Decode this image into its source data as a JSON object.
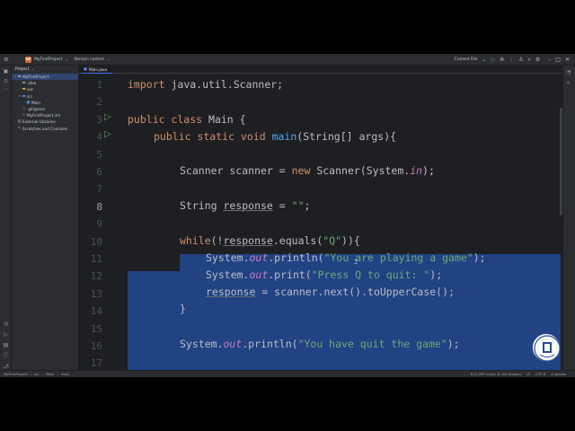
{
  "window": {
    "project_badge": "MF",
    "project_name": "MyFirstProject",
    "vcs": "Version control",
    "run_config": "Current File"
  },
  "project_panel": {
    "title": "Project",
    "tree": [
      {
        "label": "MyFirstProject",
        "indent": 0,
        "arrow": "▾",
        "icon": "folder",
        "selected": true
      },
      {
        "label": ".idea",
        "indent": 1,
        "arrow": "›",
        "icon": "folder",
        "selected": false
      },
      {
        "label": "out",
        "indent": 1,
        "arrow": "›",
        "icon": "folder-orange",
        "selected": false
      },
      {
        "label": "src",
        "indent": 1,
        "arrow": "▾",
        "icon": "folder-blue",
        "selected": false
      },
      {
        "label": "Main",
        "indent": 2,
        "arrow": "",
        "icon": "class",
        "selected": false
      },
      {
        "label": ".gitignore",
        "indent": 1,
        "arrow": "",
        "icon": "file",
        "selected": false
      },
      {
        "label": "MyFirstProject.iml",
        "indent": 1,
        "arrow": "",
        "icon": "file",
        "selected": false
      },
      {
        "label": "External Libraries",
        "indent": 0,
        "arrow": "›",
        "icon": "library",
        "selected": false
      },
      {
        "label": "Scratches and Consoles",
        "indent": 0,
        "arrow": "",
        "icon": "scratch",
        "selected": false
      }
    ]
  },
  "editor": {
    "tab_label": "Main.java",
    "line_numbers": [
      "1",
      "2",
      "3",
      "4",
      "5",
      "6",
      "7",
      "8",
      "9",
      "10",
      "11",
      "12",
      "13",
      "14",
      "15",
      "16",
      "17"
    ],
    "active_line": "8",
    "lines": {
      "l1": {
        "kw": "import",
        "rest": " java.util.Scanner;"
      },
      "l3": {
        "kw": "public class",
        "rest": " Main {"
      },
      "l4": {
        "kw": "public static void",
        "fn": "main",
        "rest": "(String[] args){"
      },
      "l6": {
        "a": "Scanner scanner = ",
        "kw": "new",
        "b": " Scanner(System.",
        "field": "in",
        "c": ");"
      },
      "l8": {
        "a": "String ",
        "var": "response",
        "b": " = ",
        "str": "\"\"",
        "c": ";"
      },
      "l10": {
        "kw": "while",
        "a": "(!",
        "var": "response",
        "b": ".equals(",
        "str": "\"Q\"",
        "c": ")){"
      },
      "l11": {
        "a": "System.",
        "field": "out",
        "b": ".println(",
        "str": "\"You are playing a game\"",
        "c": ");"
      },
      "l12": {
        "a": "System.",
        "field": "out",
        "b": ".print(",
        "str": "\"Press Q to quit: \"",
        "c": ");"
      },
      "l13": {
        "var": "response",
        "a": " = scanner.next().toUpperCase();"
      },
      "l14": {
        "a": "}"
      },
      "l16": {
        "a": "System.",
        "field": "out",
        "b": ".println(",
        "str": "\"You have quit the game\"",
        "c": ");"
      }
    }
  },
  "status_bar": {
    "crumbs": [
      "MyFirstProject",
      "src",
      "Main",
      "main"
    ],
    "selection": "8:9 (287 chars, 8 line breaks)",
    "line_sep": "LF",
    "encoding": "UTF-8",
    "indent": "4 spaces"
  }
}
